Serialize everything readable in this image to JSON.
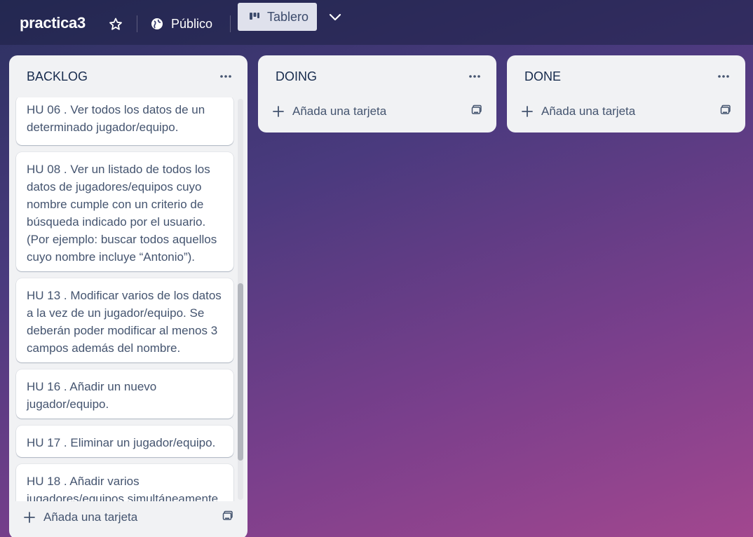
{
  "header": {
    "board_name": "practica3",
    "visibility_label": "Público",
    "view_label": "Tablero"
  },
  "lists": {
    "backlog": {
      "title": "BACKLOG",
      "add_label": "Añada una tarjeta",
      "cards": [
        {
          "line1": "HU 06 . Ver todos los datos de un",
          "line2": "determinado jugador/equipo."
        },
        {
          "line1": "HU 08 . Ver un listado de todos los",
          "line2": "datos de jugadores/equipos cuyo",
          "line3": "nombre cumple con un criterio de",
          "line4": "búsqueda indicado por el usuario.",
          "line5": "(Por ejemplo: buscar todos aquellos",
          "line6": "cuyo nombre incluye “Antonio”)."
        },
        {
          "line1": "HU 13 . Modificar varios de los datos",
          "line2": "a la vez de un jugador/equipo. Se",
          "line3": "deberán poder modificar al menos 3",
          "line4": "campos además del nombre."
        },
        {
          "line1": "HU 16 . Añadir un nuevo",
          "line2": "jugador/equipo."
        },
        {
          "line1": "HU 17 . Eliminar un jugador/equipo."
        },
        {
          "line1": "HU 18 . Añadir varios",
          "line2": "jugadores/equipos simultáneamente"
        }
      ]
    },
    "doing": {
      "title": "DOING",
      "add_label": "Añada una tarjeta"
    },
    "done": {
      "title": "DONE",
      "add_label": "Añada una tarjeta"
    }
  },
  "icons": {
    "star": "star-icon",
    "visibility": "globe-icon",
    "view": "board-icon",
    "menu": "more-dots-icon",
    "add": "plus-icon",
    "template": "card-template-icon"
  }
}
